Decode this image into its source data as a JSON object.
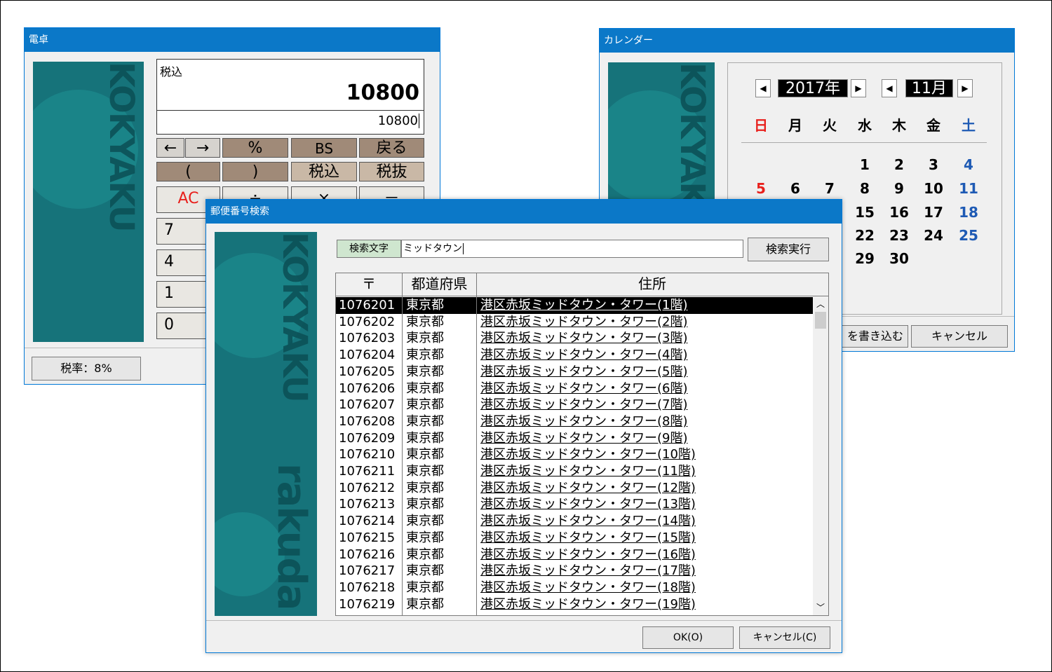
{
  "calculator": {
    "title": "電卓",
    "mode_label": "税込",
    "result": "10800",
    "input": "10800",
    "keys_row1": [
      "←",
      "→",
      "%",
      "BS",
      "戻る"
    ],
    "keys_row2": [
      "(",
      ")",
      "税込",
      "税抜"
    ],
    "keys_row3": [
      "AC",
      "÷",
      "×",
      "－"
    ],
    "digits_col": [
      "7",
      "4",
      "1",
      "0"
    ],
    "tax_rate_button": "税率：8%",
    "brand_text": "KOKYAKU"
  },
  "calendar": {
    "title": "カレンダー",
    "year": "2017年",
    "month": "11月",
    "weekdays": [
      "日",
      "月",
      "火",
      "水",
      "木",
      "金",
      "土"
    ],
    "weeks": [
      [
        "",
        "",
        "",
        "1",
        "2",
        "3",
        "4"
      ],
      [
        "5",
        "6",
        "7",
        "8",
        "9",
        "10",
        "11"
      ],
      [
        "",
        "",
        "",
        "15",
        "16",
        "17",
        "18"
      ],
      [
        "",
        "",
        "",
        "22",
        "23",
        "24",
        "25"
      ],
      [
        "",
        "",
        "",
        "29",
        "30",
        "",
        ""
      ]
    ],
    "write_button": "を書き込む",
    "cancel_button": "キャンセル",
    "colors": {
      "sunday": "#e8201c",
      "saturday": "#1e5ab4",
      "weekday": "#000000"
    }
  },
  "postal": {
    "title": "郵便番号検索",
    "search_label": "検索文字",
    "search_value": "ミッドタウン",
    "search_button": "検索実行",
    "columns": [
      "〒",
      "都道府県",
      "住所"
    ],
    "rows": [
      [
        "1076201",
        "東京都",
        "港区赤坂ミッドタウン・タワー(1階)"
      ],
      [
        "1076202",
        "東京都",
        "港区赤坂ミッドタウン・タワー(2階)"
      ],
      [
        "1076203",
        "東京都",
        "港区赤坂ミッドタウン・タワー(3階)"
      ],
      [
        "1076204",
        "東京都",
        "港区赤坂ミッドタウン・タワー(4階)"
      ],
      [
        "1076205",
        "東京都",
        "港区赤坂ミッドタウン・タワー(5階)"
      ],
      [
        "1076206",
        "東京都",
        "港区赤坂ミッドタウン・タワー(6階)"
      ],
      [
        "1076207",
        "東京都",
        "港区赤坂ミッドタウン・タワー(7階)"
      ],
      [
        "1076208",
        "東京都",
        "港区赤坂ミッドタウン・タワー(8階)"
      ],
      [
        "1076209",
        "東京都",
        "港区赤坂ミッドタウン・タワー(9階)"
      ],
      [
        "1076210",
        "東京都",
        "港区赤坂ミッドタウン・タワー(10階)"
      ],
      [
        "1076211",
        "東京都",
        "港区赤坂ミッドタウン・タワー(11階)"
      ],
      [
        "1076212",
        "東京都",
        "港区赤坂ミッドタウン・タワー(12階)"
      ],
      [
        "1076213",
        "東京都",
        "港区赤坂ミッドタウン・タワー(13階)"
      ],
      [
        "1076214",
        "東京都",
        "港区赤坂ミッドタウン・タワー(14階)"
      ],
      [
        "1076215",
        "東京都",
        "港区赤坂ミッドタウン・タワー(15階)"
      ],
      [
        "1076216",
        "東京都",
        "港区赤坂ミッドタウン・タワー(16階)"
      ],
      [
        "1076217",
        "東京都",
        "港区赤坂ミッドタウン・タワー(17階)"
      ],
      [
        "1076218",
        "東京都",
        "港区赤坂ミッドタウン・タワー(18階)"
      ],
      [
        "1076219",
        "東京都",
        "港区赤坂ミッドタウン・タワー(19階)"
      ]
    ],
    "selected_row": 0,
    "ok_button": "OK(O)",
    "cancel_button": "キャンセル(C)",
    "brand_text_top": "KOKYAKU",
    "brand_text_bottom": "rakuda"
  }
}
